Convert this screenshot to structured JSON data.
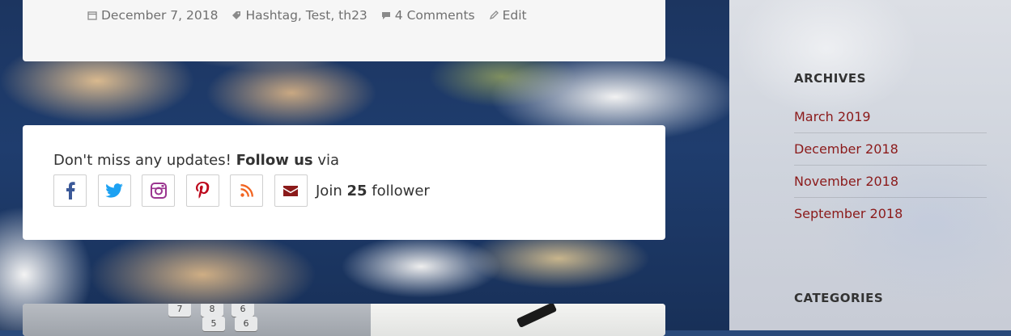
{
  "post_meta": {
    "date": "December 7, 2018",
    "tags": "Hashtag, Test, th23",
    "comments": "4 Comments",
    "edit": "Edit"
  },
  "follow": {
    "prefix": "Don't miss any updates! ",
    "bold": "Follow us",
    "suffix": " via",
    "join_prefix": "Join ",
    "join_count": "25",
    "join_suffix": " follower",
    "icons": [
      "facebook-icon",
      "twitter-icon",
      "instagram-icon",
      "pinterest-icon",
      "rss-icon",
      "email-icon"
    ]
  },
  "next_post": {
    "calculator_keys": [
      "7",
      "8",
      "6",
      "5",
      "6"
    ]
  },
  "sidebar": {
    "archives_title": "ARCHIVES",
    "archives": [
      "March 2019",
      "December 2018",
      "November 2018",
      "September 2018"
    ],
    "categories_title": "CATEGORIES"
  },
  "colors": {
    "link": "#8b1a1a",
    "facebook": "#3b5998",
    "twitter": "#1da1f2",
    "instagram": "#9b3590",
    "pinterest": "#bd081c",
    "rss": "#f26522",
    "email": "#8b1a1a"
  }
}
